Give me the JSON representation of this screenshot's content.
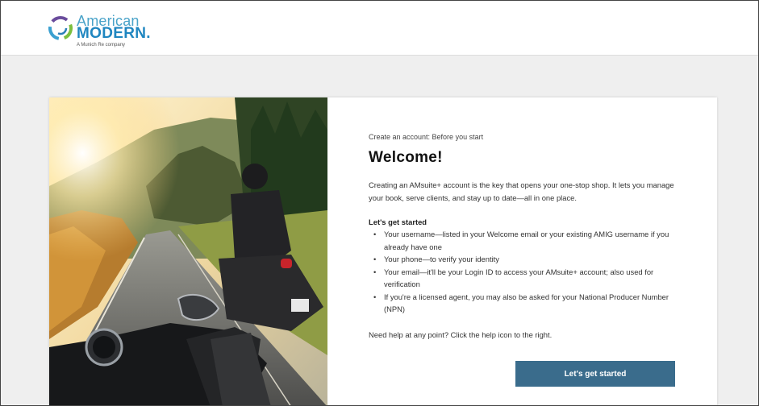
{
  "brand": {
    "name_line1": "American",
    "name_line2": "MODERN.",
    "tagline": "A Munich Re company"
  },
  "content": {
    "step_label": "Create an account: Before you start",
    "title": "Welcome!",
    "intro": "Creating an AMsuite+ account is the key that opens your one-stop shop. It lets you manage your book, serve clients, and stay up to date—all in one place.",
    "subheading": "Let's get started",
    "items": [
      "Your username—listed in your Welcome email or your existing AMIG username if you already have one",
      "Your phone—to verify your identity",
      "Your email—it'll be your Login ID to access your AMsuite+ account; also used for verification",
      "If you're a licensed agent, you may also be asked for your National Producer Number (NPN)"
    ],
    "help_text": "Need help at any point? Click the help icon to the right.",
    "cta_label": "Let's get started"
  },
  "colors": {
    "button": "#3a6c8c",
    "brand_blue": "#1f86c0",
    "page_bg": "#efefef"
  }
}
